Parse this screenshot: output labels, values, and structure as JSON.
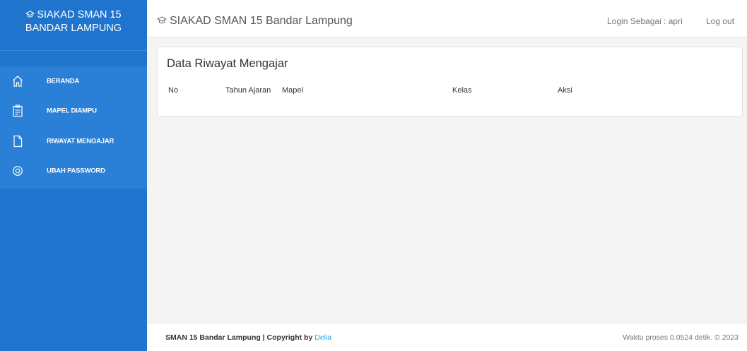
{
  "sidebar": {
    "brand_line1": "SIAKAD SMAN 15",
    "brand_line2": "BANDAR LAMPUNG",
    "brand_icon": "graduation-cap-icon",
    "items": [
      {
        "label": "BERANDA",
        "icon": "home-icon"
      },
      {
        "label": "MAPEL DIAMPU",
        "icon": "clipboard-icon"
      },
      {
        "label": "RIWAYAT MENGAJAR",
        "icon": "document-icon"
      },
      {
        "label": "UBAH PASSWORD",
        "icon": "lifebuoy-icon"
      }
    ]
  },
  "topbar": {
    "title": "SIAKAD SMAN 15 Bandar Lampung",
    "login_as": "Login Sebagai : apri",
    "logout_label": "Log out"
  },
  "main": {
    "card_title": "Data Riwayat Mengajar",
    "columns": [
      "No",
      "Tahun Ajaran",
      "Mapel",
      "Kelas",
      "Aksi"
    ]
  },
  "footer": {
    "left_text": "SMAN 15 Bandar Lampung | Copyright by",
    "author": "Delia",
    "right_text": "Waktu proses 0.0524 detik. © 2023"
  },
  "colors": {
    "sidebar_bg": "#2076cf",
    "menu_bg": "#2a7fd6",
    "link": "#2ea6e8",
    "content_bg": "#f4f4f4"
  }
}
